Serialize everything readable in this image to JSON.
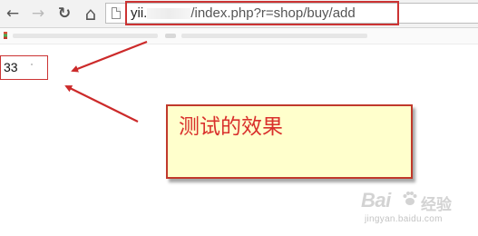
{
  "browser": {
    "back_icon": "←",
    "forward_icon": "→",
    "reload_icon": "↻",
    "home_icon": "⌂",
    "url_host": "yii.",
    "url_path": "/index.php?r=shop/buy/add"
  },
  "content": {
    "output_value": "33"
  },
  "annotation": {
    "callout_text": "测试的效果"
  },
  "watermark": {
    "brand": "Bai",
    "product": "经验",
    "domain": "jingyan.baidu.com"
  },
  "colors": {
    "annotation_red": "#cc3333",
    "callout_fill": "#ffffcc",
    "callout_text": "#d9302c"
  }
}
